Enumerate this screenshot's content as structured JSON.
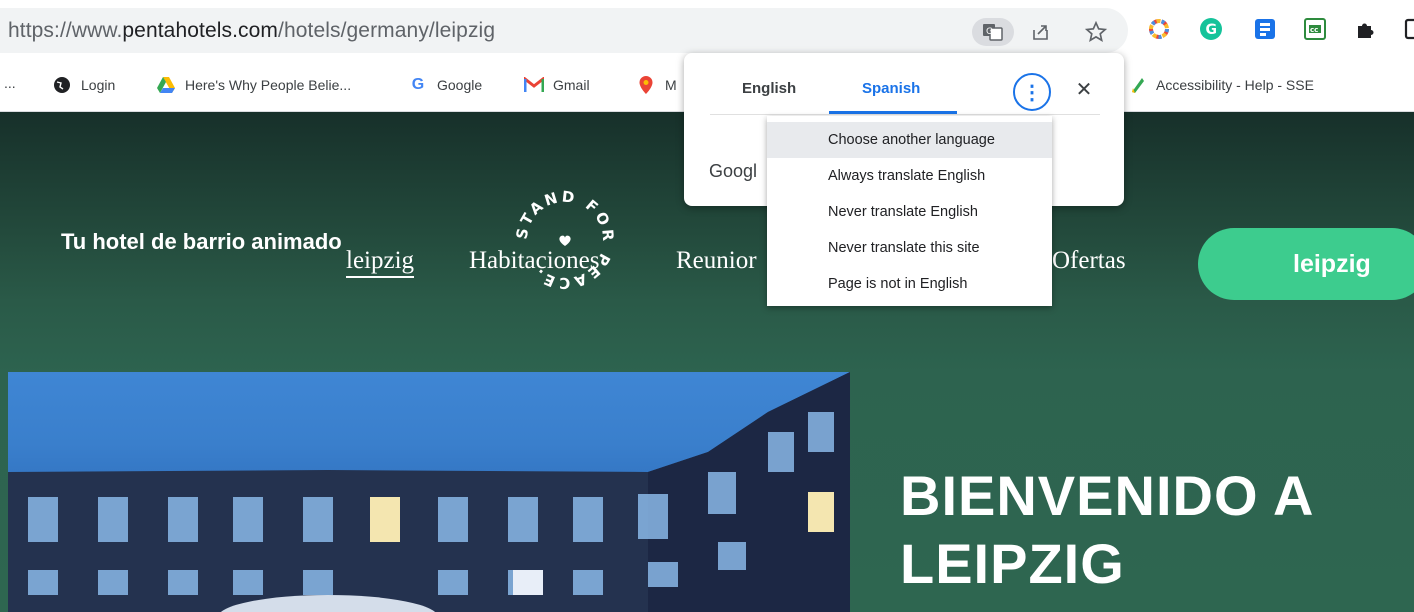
{
  "browser": {
    "url_prefix": "https://www.",
    "url_domain": "pentahotels.com",
    "url_path": "/hotels/germany/leipzig",
    "icons": [
      "translate-icon",
      "share-icon",
      "star-icon"
    ],
    "extensions": [
      "color-wheel-extension-icon",
      "grammarly-extension-icon",
      "extension-icon-blue",
      "extension-icon-green",
      "puzzle-icon"
    ]
  },
  "bookmarks": [
    {
      "label": "...",
      "icon": "none"
    },
    {
      "label": "Login",
      "icon": "globe-icon"
    },
    {
      "label": "Here's Why People Belie...",
      "icon": "google-drive-icon"
    },
    {
      "label": "Google",
      "icon": "google-icon"
    },
    {
      "label": "Gmail",
      "icon": "gmail-icon"
    },
    {
      "label": "M",
      "icon": "maps-icon"
    },
    {
      "label": "Accessibility - Help - SSE",
      "icon": "bookmark-icon"
    }
  ],
  "site": {
    "tagline": "Tu hotel de barrio animado",
    "nav": [
      "leipzig",
      "Habitaciones",
      "Reunior",
      "Ofertas"
    ],
    "cta": "leipzig",
    "badge_text": "STAND FOR PEACE.",
    "welcome_line1": "BIENVENIDO A",
    "welcome_line2": "LEIPZIG"
  },
  "translate": {
    "tabs": [
      "English",
      "Spanish"
    ],
    "active_tab": "Spanish",
    "footer": "Googl"
  },
  "menu": {
    "items": [
      "Choose another language",
      "Always translate English",
      "Never translate English",
      "Never translate this site",
      "Page is not in English"
    ],
    "hovered_index": 0
  },
  "colors": {
    "accent": "#1a73e8",
    "page_green": "#2e6650",
    "cta_green": "#3dcc8e"
  }
}
